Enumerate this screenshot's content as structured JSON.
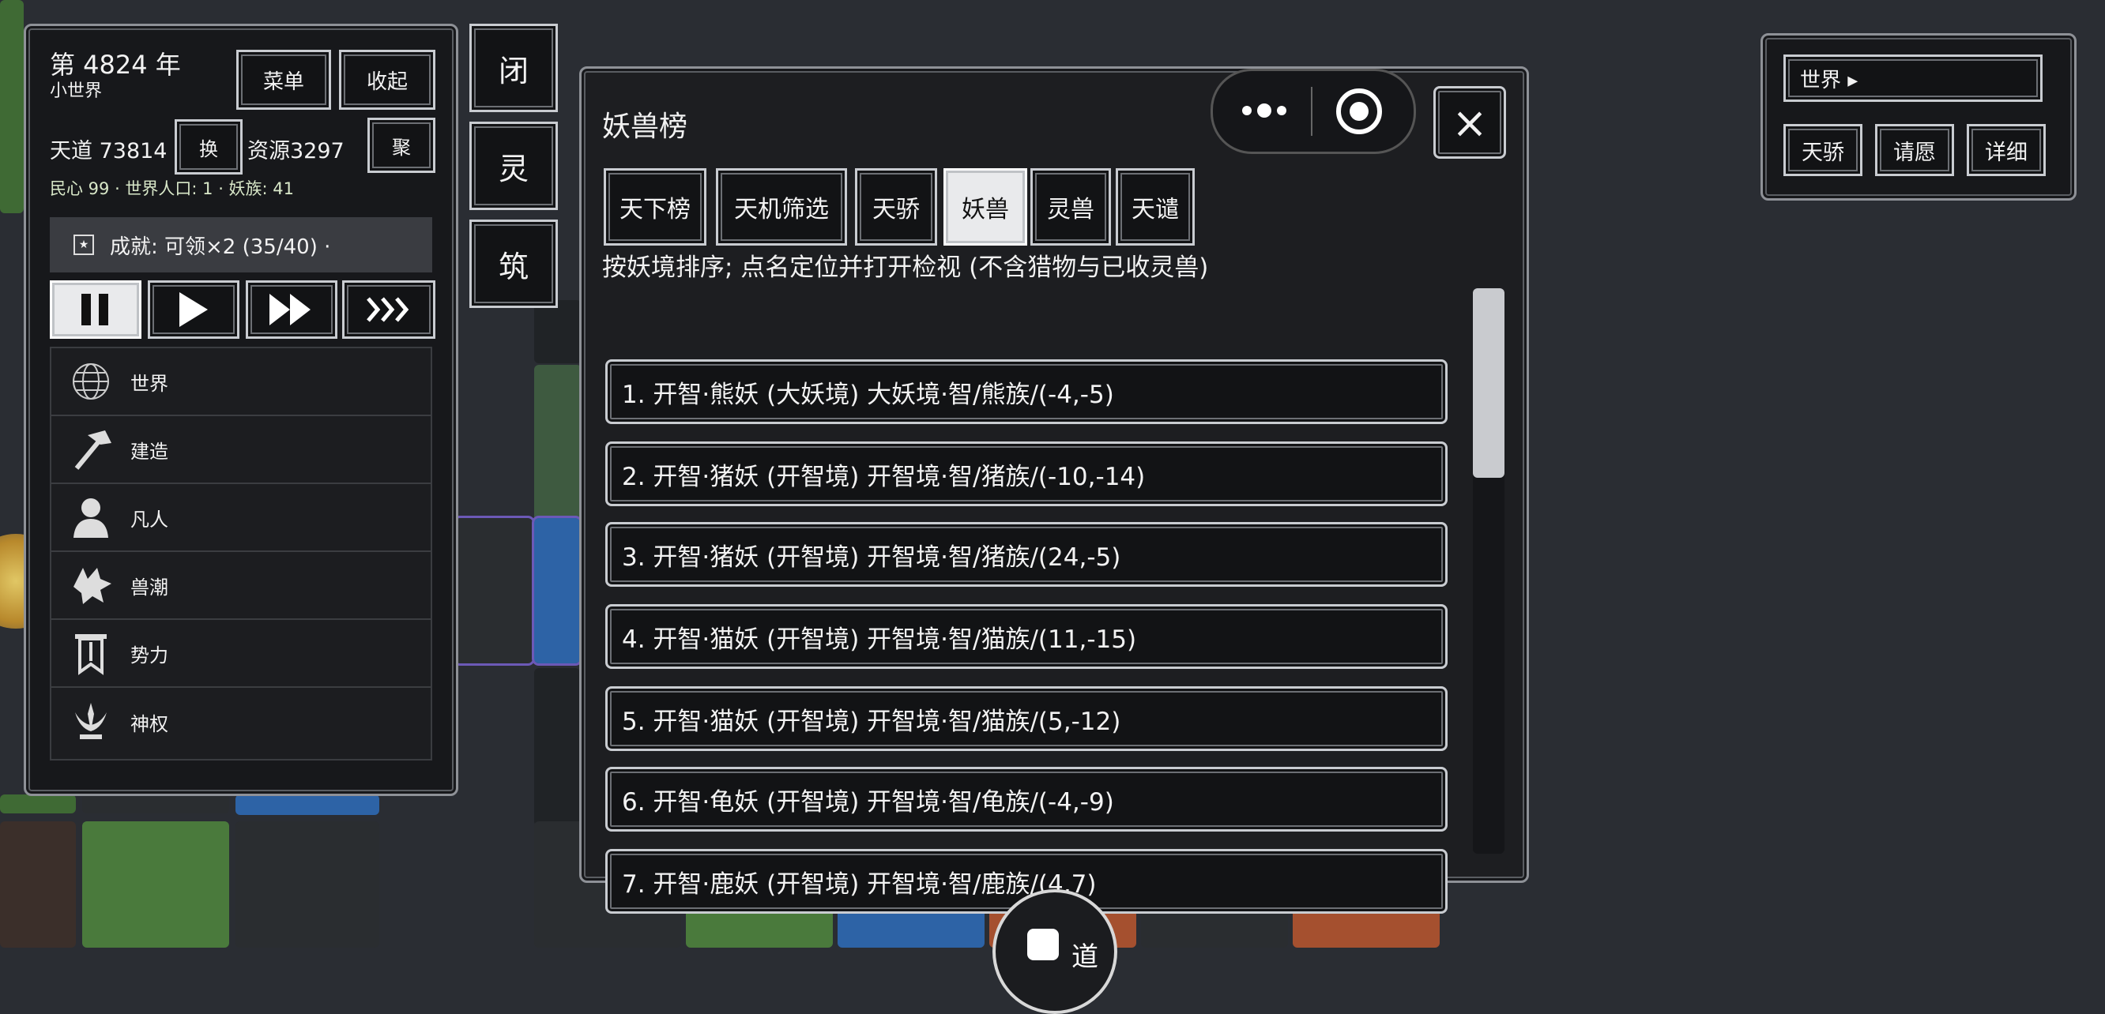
{
  "left_panel": {
    "year": "第 4824 年",
    "world_name": "小世界",
    "menu_button": "菜单",
    "collapse_button": "收起",
    "tiandao": "天道 73814",
    "swap_button": "换",
    "resources": "资源3297",
    "gather_button": "聚",
    "stats_line": "民心 99 · 世界人口: 1 · 妖族: 41",
    "achievement": "成就: 可领×2 (35/40) ·",
    "speed_controls": [
      "pause",
      "play",
      "fast",
      "fastest"
    ],
    "menu": [
      {
        "label": "世界",
        "icon": "globe-icon"
      },
      {
        "label": "建造",
        "icon": "hammer-icon"
      },
      {
        "label": "凡人",
        "icon": "person-icon"
      },
      {
        "label": "兽潮",
        "icon": "wolf-icon"
      },
      {
        "label": "势力",
        "icon": "banner-icon"
      },
      {
        "label": "神权",
        "icon": "trident-icon"
      }
    ]
  },
  "side_buttons": [
    "闭",
    "灵",
    "筑"
  ],
  "rank_window": {
    "title": "妖兽榜",
    "close": "×",
    "tabs": [
      {
        "label": "天下榜",
        "active": false
      },
      {
        "label": "天机筛选",
        "active": false
      },
      {
        "label": "天骄",
        "active": false
      },
      {
        "label": "妖兽",
        "active": true
      },
      {
        "label": "灵兽",
        "active": false
      },
      {
        "label": "天谴",
        "active": false
      }
    ],
    "subtitle": "按妖境排序; 点名定位并打开检视 (不含猎物与已收灵兽)",
    "rows": [
      "1. 开智·熊妖 (大妖境)   大妖境·智/熊族/(-4,-5)",
      "2. 开智·猪妖 (开智境)   开智境·智/猪族/(-10,-14)",
      "3. 开智·猪妖 (开智境)   开智境·智/猪族/(24,-5)",
      "4. 开智·猫妖 (开智境)   开智境·智/猫族/(11,-15)",
      "5. 开智·猫妖 (开智境)   开智境·智/猫族/(5,-12)",
      "6. 开智·龟妖 (开智境)   开智境·智/龟族/(-4,-9)",
      "7. 开智·鹿妖 (开智境)   开智境·智/鹿族/(4,7)"
    ]
  },
  "top_right": {
    "world_selector": "世界 ▸",
    "buttons": [
      "天骄",
      "请愿",
      "详细"
    ]
  },
  "dao_button": "道"
}
